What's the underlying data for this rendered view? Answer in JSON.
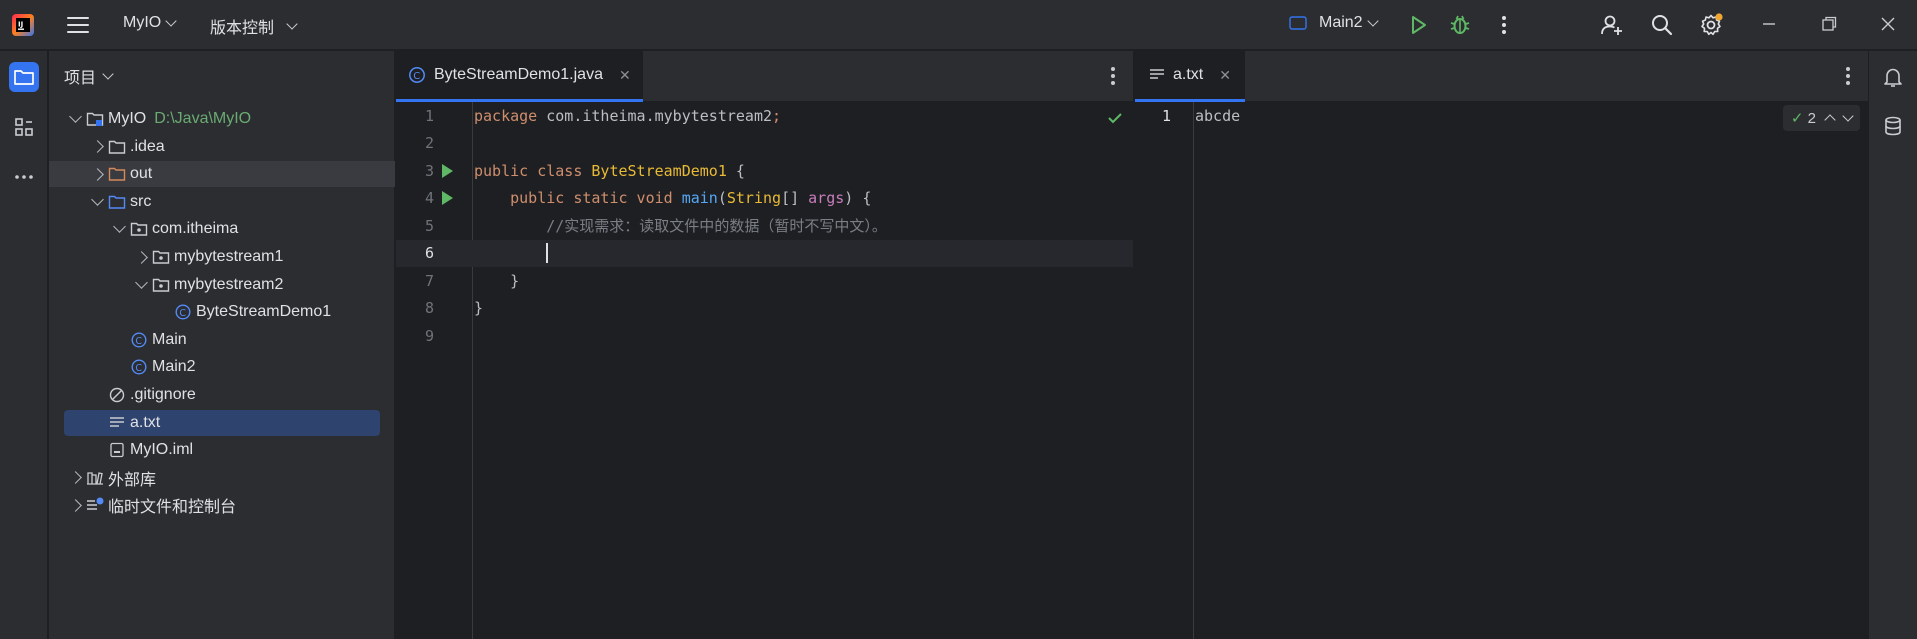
{
  "titlebar": {
    "project_name": "MyIO",
    "vcs_label": "版本控制",
    "run_config": "Main2"
  },
  "project_panel": {
    "header": "项目",
    "tree": [
      {
        "label": "MyIO",
        "hint": "D:\\Java\\MyIO",
        "icon": "module-folder-icon",
        "depth": 0,
        "expanded": true
      },
      {
        "label": ".idea",
        "icon": "folder-icon",
        "depth": 1,
        "expanded": false
      },
      {
        "label": "out",
        "icon": "excluded-folder-icon",
        "depth": 1,
        "expanded": false
      },
      {
        "label": "src",
        "icon": "source-folder-icon",
        "depth": 1,
        "expanded": true
      },
      {
        "label": "com.itheima",
        "icon": "package-icon",
        "depth": 2,
        "expanded": true
      },
      {
        "label": "mybytestream1",
        "icon": "package-icon",
        "depth": 3,
        "expanded": false
      },
      {
        "label": "mybytestream2",
        "icon": "package-icon",
        "depth": 3,
        "expanded": true
      },
      {
        "label": "ByteStreamDemo1",
        "icon": "java-class-icon",
        "depth": 4
      },
      {
        "label": "Main",
        "icon": "java-class-icon",
        "depth": 2
      },
      {
        "label": "Main2",
        "icon": "java-class-icon",
        "depth": 2
      },
      {
        "label": ".gitignore",
        "icon": "ignore-file-icon",
        "depth": 1
      },
      {
        "label": "a.txt",
        "icon": "text-file-icon",
        "depth": 1,
        "selected": true
      },
      {
        "label": "MyIO.iml",
        "icon": "iml-file-icon",
        "depth": 1
      },
      {
        "label": "外部库",
        "icon": "library-icon",
        "depth": 0,
        "expanded": false
      },
      {
        "label": "临时文件和控制台",
        "icon": "scratch-icon",
        "depth": 0,
        "expanded": false
      }
    ]
  },
  "editor_left": {
    "tab_label": "ByteStreamDemo1.java",
    "lines": [
      {
        "n": "1",
        "tokens": [
          [
            "kw",
            "package "
          ],
          [
            "pkg",
            "com.itheima.mybytestream2"
          ],
          [
            "kw",
            ";"
          ]
        ]
      },
      {
        "n": "2",
        "tokens": []
      },
      {
        "n": "3",
        "run": true,
        "tokens": [
          [
            "kw",
            "public class "
          ],
          [
            "cls",
            "ByteStreamDemo1"
          ],
          [
            "pkg",
            " {"
          ]
        ]
      },
      {
        "n": "4",
        "run": true,
        "tokens": [
          [
            "pkg",
            "    "
          ],
          [
            "kw",
            "public static void "
          ],
          [
            "fn",
            "main"
          ],
          [
            "pkg",
            "("
          ],
          [
            "cls",
            "String"
          ],
          [
            "pkg",
            "[] "
          ],
          [
            "param",
            "args"
          ],
          [
            "pkg",
            ") {"
          ]
        ]
      },
      {
        "n": "5",
        "tokens": [
          [
            "pkg",
            "        "
          ],
          [
            "cmt",
            "//实现需求：读取文件中的数据（暂时不写中文）。"
          ]
        ]
      },
      {
        "n": "6",
        "current": true,
        "tokens": [
          [
            "pkg",
            "        "
          ]
        ]
      },
      {
        "n": "7",
        "tokens": [
          [
            "pkg",
            "    }"
          ]
        ]
      },
      {
        "n": "8",
        "tokens": [
          [
            "pkg",
            "}"
          ]
        ]
      },
      {
        "n": "9",
        "tokens": []
      }
    ]
  },
  "editor_right": {
    "tab_label": "a.txt",
    "lines": [
      {
        "n": "1",
        "text": "abcde"
      }
    ],
    "inspection_count": "2"
  },
  "colors": {
    "accent": "#3574f0",
    "run_green": "#5fb865",
    "selection": "#2e436e",
    "keyword": "#cf8e6d",
    "function": "#56a8f5",
    "class": "#e8ba36"
  }
}
